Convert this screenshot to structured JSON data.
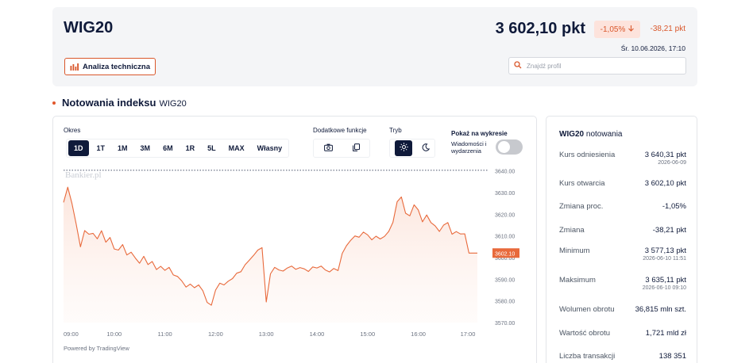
{
  "header": {
    "index_name": "WIG20",
    "tech_analysis_label": "Analiza techniczna",
    "price": "3 602,10 pkt",
    "pct_change": "-1,05%",
    "abs_change": "-38,21 pkt",
    "datetime": "Śr. 10.06.2026, 17:10",
    "profile_search_placeholder": "Znajdź profil"
  },
  "section": {
    "title": "Notowania indeksu",
    "subtitle": "WIG20"
  },
  "controls": {
    "period_label": "Okres",
    "periods": [
      "1D",
      "1T",
      "1M",
      "3M",
      "6M",
      "1R",
      "5L",
      "MAX",
      "Własny"
    ],
    "active_period": "1D",
    "extra_functions_label": "Dodatkowe funkcje",
    "mode_label": "Tryb",
    "show_on_chart_label": "Pokaż na wykresie",
    "news_events_label": "Wiadomości i wydarzenia",
    "news_toggle_on": false
  },
  "chart_data": {
    "type": "area",
    "watermark": "Bankier.pl",
    "x_ticks": [
      "09:00",
      "10:00",
      "11:00",
      "12:00",
      "13:00",
      "14:00",
      "15:00",
      "16:00",
      "17:00"
    ],
    "y_ticks": [
      "3640.00",
      "3630.00",
      "3620.00",
      "3610.00",
      "3600.00",
      "3590.00",
      "3580.00",
      "3570.00"
    ],
    "ylim": [
      3570,
      3641
    ],
    "reference_level": 3640.31,
    "last_price": 3602.1,
    "last_price_label": "3602.10",
    "line_color": "#e8693b",
    "x": [
      "09:00",
      "09:05",
      "09:10",
      "09:15",
      "09:20",
      "09:25",
      "09:30",
      "09:35",
      "09:40",
      "09:45",
      "09:50",
      "09:55",
      "10:00",
      "10:05",
      "10:10",
      "10:15",
      "10:20",
      "10:25",
      "10:30",
      "10:35",
      "10:40",
      "10:45",
      "10:50",
      "10:55",
      "11:00",
      "11:05",
      "11:10",
      "11:15",
      "11:20",
      "11:25",
      "11:30",
      "11:35",
      "11:40",
      "11:45",
      "11:50",
      "11:55",
      "12:00",
      "12:05",
      "12:10",
      "12:15",
      "12:20",
      "12:25",
      "12:30",
      "12:35",
      "12:40",
      "12:45",
      "12:50",
      "12:55",
      "13:00",
      "13:05",
      "13:10",
      "13:15",
      "13:20",
      "13:25",
      "13:30",
      "13:35",
      "13:40",
      "13:45",
      "13:50",
      "13:55",
      "14:00",
      "14:05",
      "14:10",
      "14:15",
      "14:20",
      "14:25",
      "14:30",
      "14:35",
      "14:40",
      "14:45",
      "14:50",
      "14:55",
      "15:00",
      "15:05",
      "15:10",
      "15:15",
      "15:20",
      "15:25",
      "15:30",
      "15:35",
      "15:40",
      "15:45",
      "15:50",
      "15:55",
      "16:00",
      "16:05",
      "16:10",
      "16:15",
      "16:20",
      "16:25",
      "16:30",
      "16:35",
      "16:40",
      "16:45",
      "16:50",
      "16:55",
      "17:00",
      "17:05",
      "17:10"
    ],
    "values": [
      3625.5,
      3632.5,
      3625.0,
      3615.5,
      3605.0,
      3612.5,
      3610.8,
      3611.2,
      3608.7,
      3612.4,
      3607.1,
      3609.3,
      3604.0,
      3603.5,
      3606.0,
      3601.2,
      3602.5,
      3599.8,
      3597.4,
      3600.6,
      3596.8,
      3598.2,
      3594.5,
      3596.0,
      3594.1,
      3595.5,
      3592.0,
      3591.3,
      3589.2,
      3586.4,
      3587.8,
      3586.1,
      3587.4,
      3584.7,
      3579.3,
      3578.0,
      3585.0,
      3588.2,
      3587.4,
      3589.1,
      3590.3,
      3592.8,
      3593.5,
      3596.7,
      3598.8,
      3601.0,
      3603.5,
      3604.6,
      3579.5,
      3592.5,
      3595.5,
      3594.3,
      3593.8,
      3595.2,
      3596.1,
      3594.6,
      3595.4,
      3594.8,
      3593.6,
      3595.7,
      3595.2,
      3596.1,
      3594.3,
      3593.4,
      3595.0,
      3594.0,
      3602.0,
      3605.5,
      3608.0,
      3610.0,
      3609.4,
      3611.8,
      3610.5,
      3608.2,
      3609.9,
      3608.6,
      3609.8,
      3612.1,
      3616.3,
      3625.8,
      3628.0,
      3620.5,
      3619.3,
      3624.4,
      3622.0,
      3616.5,
      3619.7,
      3616.2,
      3614.7,
      3612.1,
      3615.0,
      3616.2,
      3610.8,
      3612.0,
      3610.9,
      3611.0,
      3602.1,
      3602.1,
      3602.1
    ]
  },
  "powered_by": "Powered by TradingView",
  "quote_panel": {
    "title_bold": "WIG20",
    "title_suffix": "notowania",
    "rows": [
      {
        "label": "Kurs odniesienia",
        "value": "3 640,31 pkt",
        "sub": "2026-06-09"
      },
      {
        "label": "Kurs otwarcia",
        "value": "3 602,10 pkt",
        "sub": ""
      },
      {
        "label": "Zmiana proc.",
        "value": "-1,05%",
        "sub": ""
      },
      {
        "label": "Zmiana",
        "value": "-38,21 pkt",
        "sub": ""
      },
      {
        "label": "Minimum",
        "value": "3 577,13 pkt",
        "sub": "2026-06-10 11:51"
      },
      {
        "label": "Maksimum",
        "value": "3 635,11 pkt",
        "sub": "2026-06-10 09:10"
      },
      {
        "label": "Wolumen obrotu",
        "value": "36,815 mln szt.",
        "sub": ""
      },
      {
        "label": "Wartość obrotu",
        "value": "1,721 mld zł",
        "sub": ""
      },
      {
        "label": "Liczba transakcji",
        "value": "138 351",
        "sub": ""
      }
    ]
  },
  "colors": {
    "accent": "#d9572b",
    "dark": "#0f1a3a",
    "negative": "#d9572b"
  }
}
